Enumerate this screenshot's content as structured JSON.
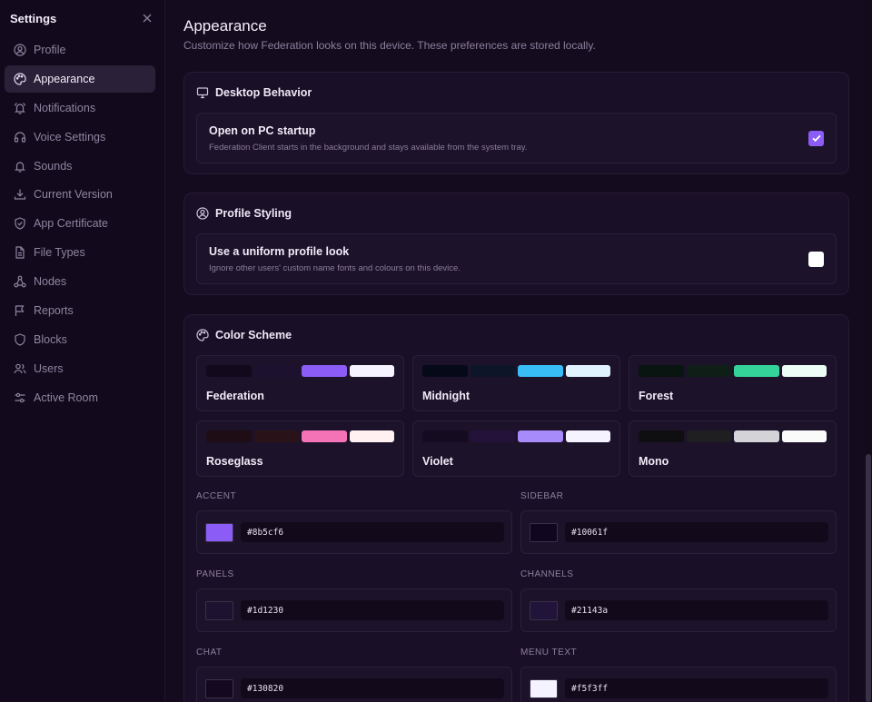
{
  "sidebar": {
    "title": "Settings",
    "close_icon": "close-icon",
    "items": [
      {
        "label": "Profile",
        "icon": "user-circle-icon"
      },
      {
        "label": "Appearance",
        "icon": "palette-icon",
        "active": true
      },
      {
        "label": "Notifications",
        "icon": "bell-ring-icon"
      },
      {
        "label": "Voice Settings",
        "icon": "headphones-icon"
      },
      {
        "label": "Sounds",
        "icon": "bell-icon"
      },
      {
        "label": "Current Version",
        "icon": "download-icon"
      },
      {
        "label": "App Certificate",
        "icon": "shield-check-icon"
      },
      {
        "label": "File Types",
        "icon": "file-icon"
      },
      {
        "label": "Nodes",
        "icon": "network-icon"
      },
      {
        "label": "Reports",
        "icon": "flag-icon"
      },
      {
        "label": "Blocks",
        "icon": "shield-icon"
      },
      {
        "label": "Users",
        "icon": "users-icon"
      },
      {
        "label": "Active Room",
        "icon": "sliders-icon"
      }
    ]
  },
  "page": {
    "title": "Appearance",
    "subtitle": "Customize how Federation looks on this device. These preferences are stored locally."
  },
  "desktop": {
    "heading": "Desktop Behavior",
    "option_title": "Open on PC startup",
    "option_desc": "Federation Client starts in the background and stays available from the system tray.",
    "checked": true
  },
  "profile_styling": {
    "heading": "Profile Styling",
    "option_title": "Use a uniform profile look",
    "option_desc": "Ignore other users' custom name fonts and colours on this device.",
    "checked": false
  },
  "color_scheme": {
    "heading": "Color Scheme",
    "schemes": [
      {
        "name": "Federation",
        "colors": [
          "#120a1c",
          "#1c1230",
          "#8b5cf6",
          "#f5f3ff"
        ]
      },
      {
        "name": "Midnight",
        "colors": [
          "#060a18",
          "#0d1528",
          "#38bdf8",
          "#e0f2fe"
        ]
      },
      {
        "name": "Forest",
        "colors": [
          "#081510",
          "#0f1f18",
          "#34d399",
          "#ecfdf5"
        ]
      },
      {
        "name": "Roseglass",
        "colors": [
          "#1e0d14",
          "#2a1219",
          "#f472b6",
          "#fff1f2"
        ]
      },
      {
        "name": "Violet",
        "colors": [
          "#140b20",
          "#24123a",
          "#a78bfa",
          "#f5f3ff"
        ]
      },
      {
        "name": "Mono",
        "colors": [
          "#0f0f11",
          "#1f1f22",
          "#d4d4d8",
          "#fafafa"
        ]
      }
    ]
  },
  "fields": [
    {
      "label": "ACCENT",
      "value": "#8b5cf6",
      "swatch": "#8b5cf6"
    },
    {
      "label": "SIDEBAR",
      "value": "#10061f",
      "swatch": "#10061f"
    },
    {
      "label": "PANELS",
      "value": "#1d1230",
      "swatch": "#1d1230"
    },
    {
      "label": "CHANNELS",
      "value": "#21143a",
      "swatch": "#21143a"
    },
    {
      "label": "CHAT",
      "value": "#130820",
      "swatch": "#130820"
    },
    {
      "label": "MENU TEXT",
      "value": "#f5f3ff",
      "swatch": "#f5f3ff"
    }
  ]
}
